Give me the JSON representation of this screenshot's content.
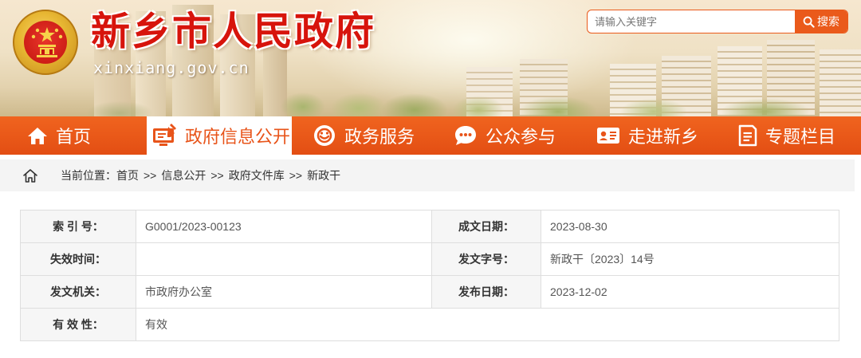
{
  "header": {
    "title": "新乡市人民政府",
    "domain": "xinxiang.gov.cn",
    "emblem_icon": "national-emblem-icon"
  },
  "search": {
    "placeholder": "请输入关键字",
    "value": "",
    "button_label": "搜索",
    "icon": "search-icon"
  },
  "nav": {
    "items": [
      {
        "label": "首页",
        "icon": "home-icon",
        "active": false
      },
      {
        "label": "政府信息公开",
        "icon": "monitor-edit-icon",
        "active": true
      },
      {
        "label": "政务服务",
        "icon": "service-icon",
        "active": false
      },
      {
        "label": "公众参与",
        "icon": "chat-bubble-icon",
        "active": false
      },
      {
        "label": "走进新乡",
        "icon": "id-card-icon",
        "active": false
      },
      {
        "label": "专题栏目",
        "icon": "document-icon",
        "active": false
      }
    ]
  },
  "breadcrumb": {
    "prefix": "当前位置：",
    "items": [
      "首页",
      "信息公开",
      "政府文件库",
      "新政干"
    ],
    "separator": ">>"
  },
  "info": {
    "index_no_label": "索 引 号：",
    "index_no_value": "G0001/2023-00123",
    "written_date_label": "成文日期：",
    "written_date_value": "2023-08-30",
    "expiry_label": "失效时间：",
    "expiry_value": "",
    "doc_no_label": "发文字号：",
    "doc_no_value": "新政干〔2023〕14号",
    "issuer_label": "发文机关：",
    "issuer_value": "市政府办公室",
    "publish_date_label": "发布日期：",
    "publish_date_value": "2023-12-02",
    "validity_label": "有 效 性：",
    "validity_value": "有效"
  },
  "colors": {
    "brand_orange": "#e8541a",
    "title_red": "#d7140c"
  }
}
